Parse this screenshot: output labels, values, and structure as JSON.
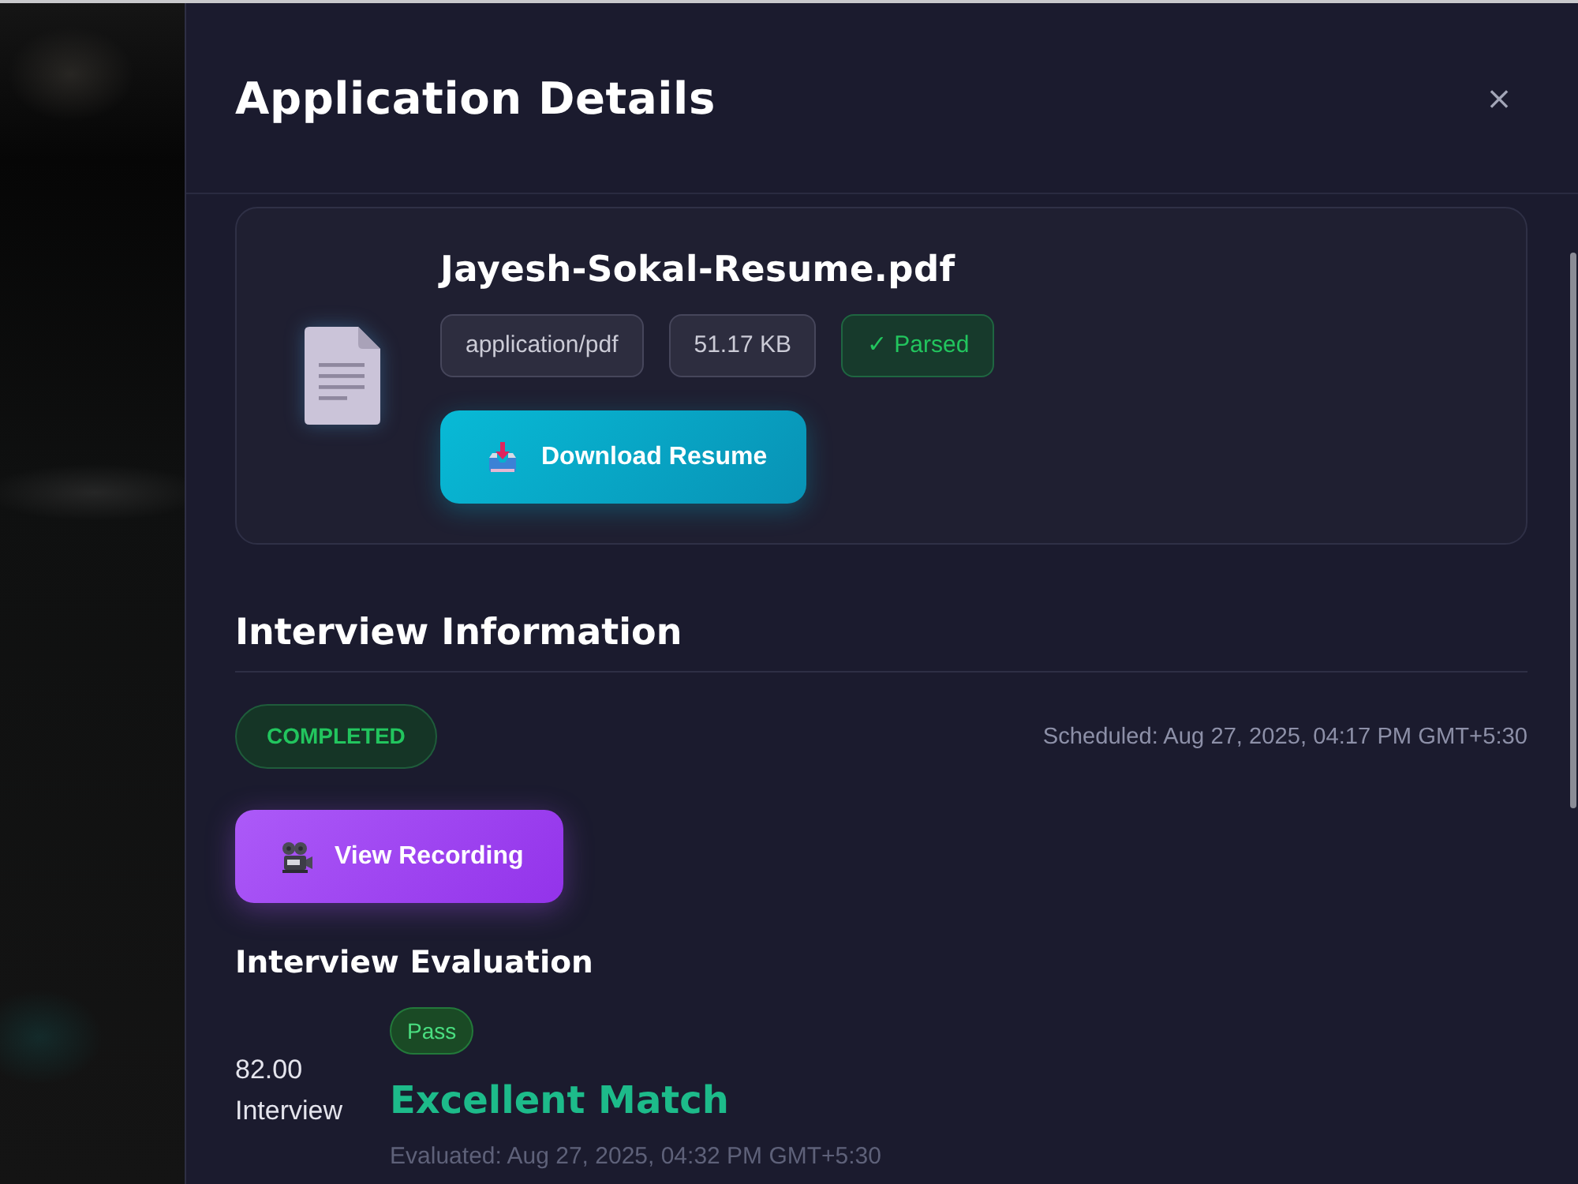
{
  "modal": {
    "title": "Application Details",
    "close": "×"
  },
  "resume": {
    "file_name": "Jayesh-Sokal-Resume.pdf",
    "chips": [
      {
        "kind": "neutral",
        "text": "application/pdf"
      },
      {
        "kind": "neutral",
        "text": "51.17 KB"
      },
      {
        "kind": "success",
        "text": "✓ Parsed"
      }
    ],
    "download_button": "Download Resume"
  },
  "interview": {
    "heading": "Interview Information",
    "status": "COMPLETED",
    "scheduled": "Scheduled: Aug 27, 2025, 04:17 PM GMT+5:30",
    "recording_button": "View Recording"
  },
  "evaluation": {
    "heading": "Interview Evaluation",
    "score": "82.00",
    "score_label": "Interview",
    "result": "Pass",
    "verdict": "Excellent Match",
    "evaluated": "Evaluated: Aug 27, 2025, 04:32 PM GMT+5:30"
  }
}
